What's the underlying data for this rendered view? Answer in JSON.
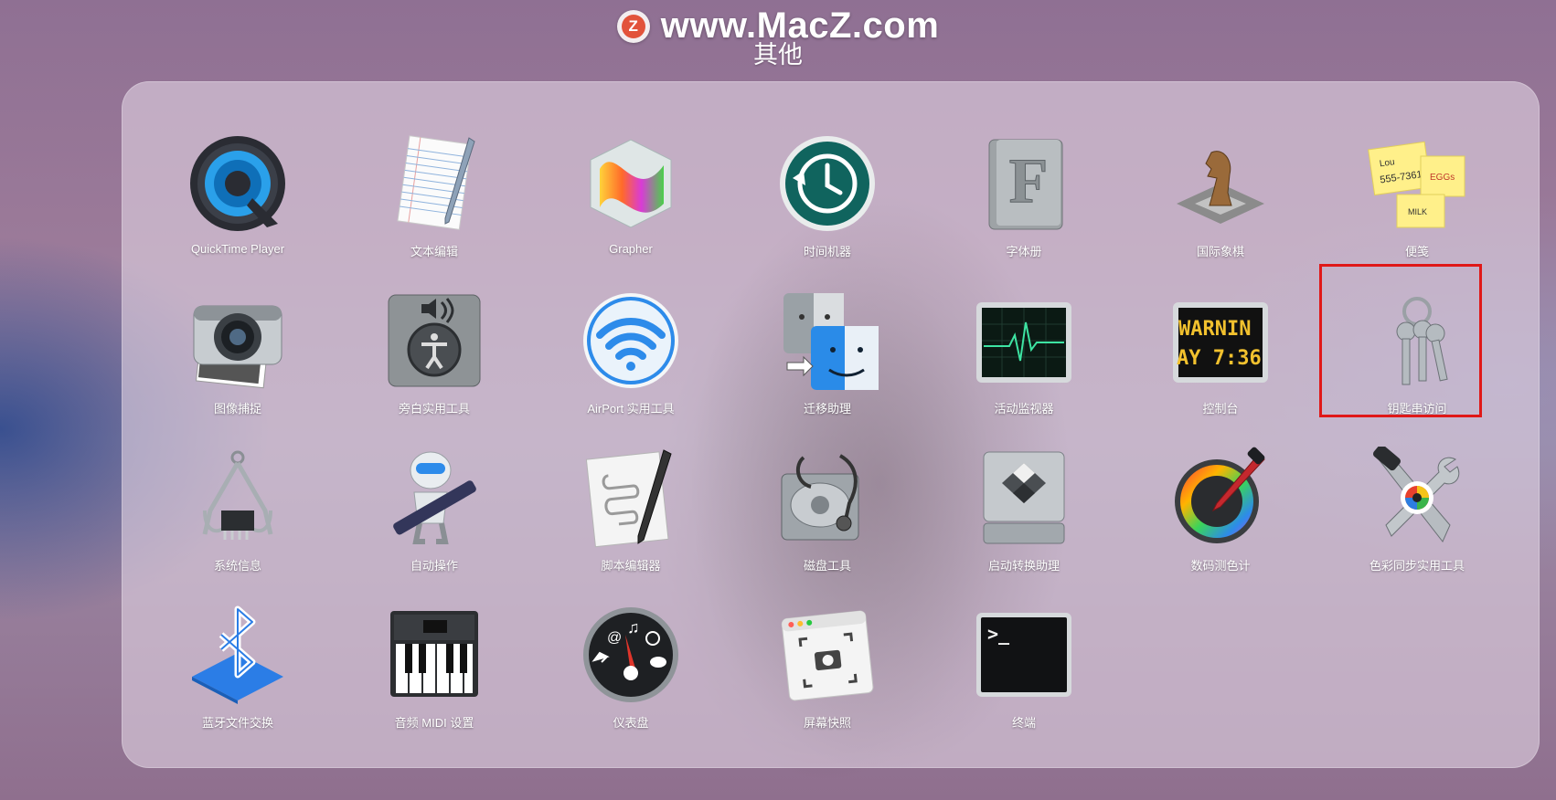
{
  "watermark": {
    "logo_letter": "Z",
    "text": "www.MacZ.com"
  },
  "folder": {
    "title": "其他"
  },
  "apps": [
    {
      "name": "QuickTime Player",
      "icon": "quicktime-icon"
    },
    {
      "name": "文本编辑",
      "icon": "textedit-icon"
    },
    {
      "name": "Grapher",
      "icon": "grapher-icon"
    },
    {
      "name": "时间机器",
      "icon": "time-machine-icon"
    },
    {
      "name": "字体册",
      "icon": "font-book-icon"
    },
    {
      "name": "国际象棋",
      "icon": "chess-icon"
    },
    {
      "name": "便笺",
      "icon": "stickies-icon",
      "note_lines": [
        "Lou",
        "555-7361",
        "EGGs",
        "MILK"
      ]
    },
    {
      "name": "图像捕捉",
      "icon": "image-capture-icon"
    },
    {
      "name": "旁白实用工具",
      "icon": "voiceover-utility-icon"
    },
    {
      "name": "AirPort 实用工具",
      "icon": "airport-utility-icon"
    },
    {
      "name": "迁移助理",
      "icon": "migration-assistant-icon"
    },
    {
      "name": "活动监视器",
      "icon": "activity-monitor-icon"
    },
    {
      "name": "控制台",
      "icon": "console-icon",
      "screen_lines": [
        "WARNIN",
        "AY 7:36"
      ]
    },
    {
      "name": "钥匙串访问",
      "icon": "keychain-access-icon",
      "highlighted": true
    },
    {
      "name": "系统信息",
      "icon": "system-information-icon"
    },
    {
      "name": "自动操作",
      "icon": "automator-icon"
    },
    {
      "name": "脚本编辑器",
      "icon": "script-editor-icon"
    },
    {
      "name": "磁盘工具",
      "icon": "disk-utility-icon"
    },
    {
      "name": "启动转换助理",
      "icon": "boot-camp-icon"
    },
    {
      "name": "数码测色计",
      "icon": "digital-color-meter-icon"
    },
    {
      "name": "色彩同步实用工具",
      "icon": "colorsync-utility-icon"
    },
    {
      "name": "蓝牙文件交换",
      "icon": "bluetooth-file-exchange-icon"
    },
    {
      "name": "音频 MIDI 设置",
      "icon": "audio-midi-setup-icon"
    },
    {
      "name": "仪表盘",
      "icon": "dashboard-icon"
    },
    {
      "name": "屏幕快照",
      "icon": "screenshot-icon"
    },
    {
      "name": "终端",
      "icon": "terminal-icon",
      "prompt": ">_"
    }
  ],
  "colors": {
    "highlight": "#e01818",
    "watermark_logo": "#e2533b"
  }
}
